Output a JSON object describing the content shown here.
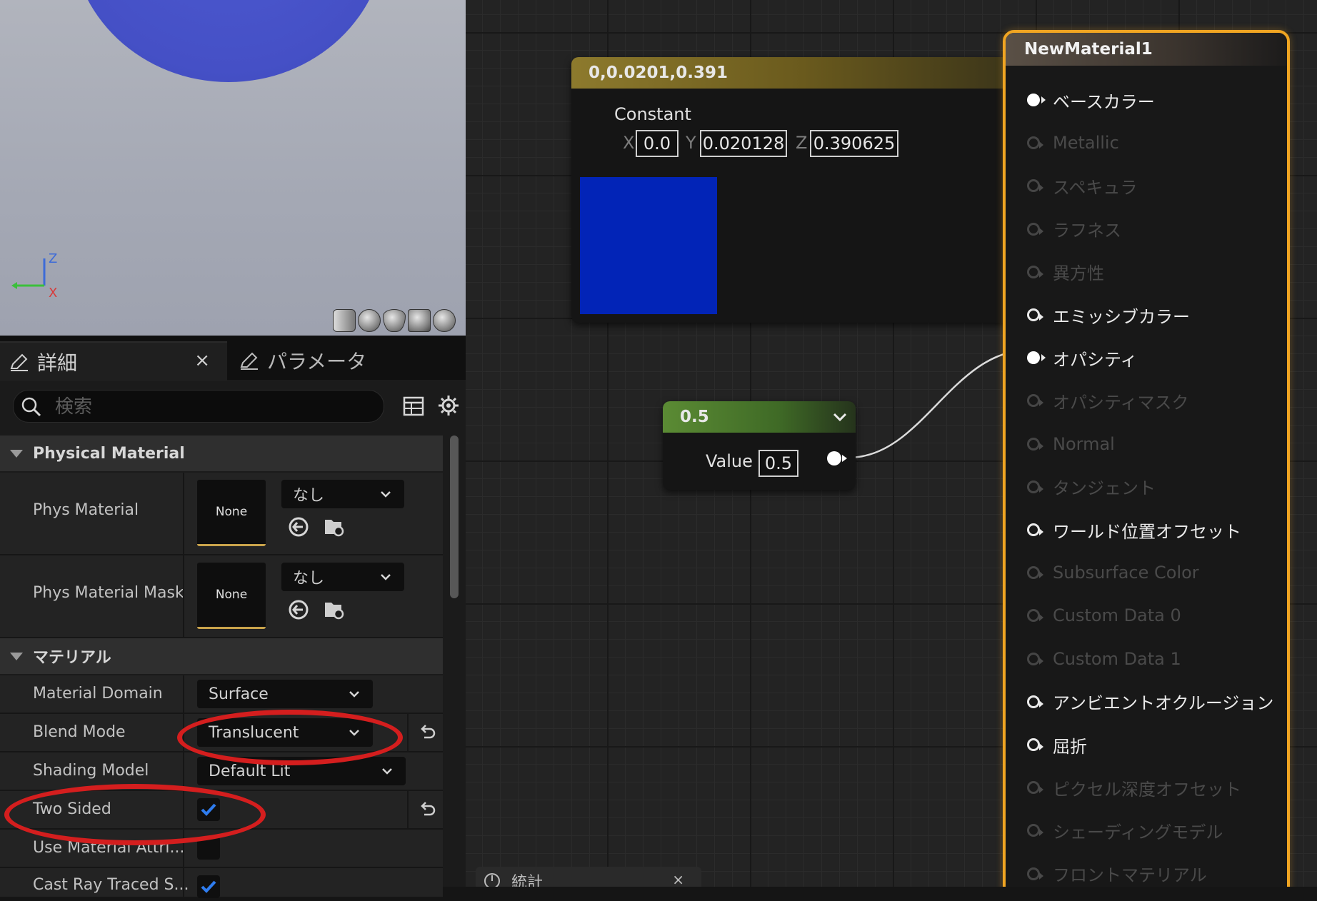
{
  "tabs": {
    "details": "詳細",
    "details_close": "×",
    "parameters": "パラメータ"
  },
  "search": {
    "placeholder": "検索",
    "value": ""
  },
  "sections": {
    "physical_material": "Physical Material",
    "material": "マテリアル"
  },
  "props": {
    "phys_material": {
      "label": "Phys Material",
      "thumb": "None",
      "value": "なし"
    },
    "phys_material_mask": {
      "label": "Phys Material Mask",
      "thumb": "None",
      "value": "なし"
    },
    "material_domain": {
      "label": "Material Domain",
      "value": "Surface"
    },
    "blend_mode": {
      "label": "Blend Mode",
      "value": "Translucent"
    },
    "shading_model": {
      "label": "Shading Model",
      "value": "Default Lit"
    },
    "two_sided": {
      "label": "Two Sided",
      "checked": true
    },
    "use_material_attributes": {
      "label": "Use Material Attri...",
      "checked": false
    },
    "cast_ray_traced": {
      "label": "Cast Ray Traced S...",
      "checked": true
    }
  },
  "viewport": {
    "axis_z": "Z",
    "axis_x": "X"
  },
  "constant_node": {
    "header": "0,0.0201,0.391",
    "type_label": "Constant",
    "x_label": "X",
    "x_value": "0.0",
    "y_label": "Y",
    "y_value": "0.020128",
    "z_label": "Z",
    "z_value": "0.390625",
    "preview_color": "#0224b7"
  },
  "scalar_node": {
    "header": "0.5",
    "value_label": "Value",
    "value": "0.5"
  },
  "result_node": {
    "title": "NewMaterial1",
    "inputs": [
      {
        "label": "ベースカラー",
        "state": "connected"
      },
      {
        "label": "Metallic",
        "state": "inactive"
      },
      {
        "label": "スペキュラ",
        "state": "inactive"
      },
      {
        "label": "ラフネス",
        "state": "inactive"
      },
      {
        "label": "異方性",
        "state": "inactive"
      },
      {
        "label": "エミッシブカラー",
        "state": "active"
      },
      {
        "label": "オパシティ",
        "state": "connected"
      },
      {
        "label": "オパシティマスク",
        "state": "inactive"
      },
      {
        "label": "Normal",
        "state": "inactive"
      },
      {
        "label": "タンジェント",
        "state": "inactive"
      },
      {
        "label": "ワールド位置オフセット",
        "state": "active"
      },
      {
        "label": "Subsurface Color",
        "state": "inactive"
      },
      {
        "label": "Custom Data 0",
        "state": "inactive"
      },
      {
        "label": "Custom Data 1",
        "state": "inactive"
      },
      {
        "label": "アンビエントオクルージョン",
        "state": "active"
      },
      {
        "label": "屈折",
        "state": "active"
      },
      {
        "label": "ピクセル深度オフセット",
        "state": "inactive"
      },
      {
        "label": "シェーディングモデル",
        "state": "inactive"
      },
      {
        "label": "フロントマテリアル",
        "state": "inactive"
      }
    ]
  },
  "bottom_tab": {
    "label": "統計",
    "close": "×"
  },
  "colors": {
    "accent_orange": "#f0a522",
    "annotation_red": "#d41e1e",
    "constant_header": "#8d7a2d",
    "scalar_header": "#5b8b34",
    "checkbox_check": "#2f7df0"
  }
}
